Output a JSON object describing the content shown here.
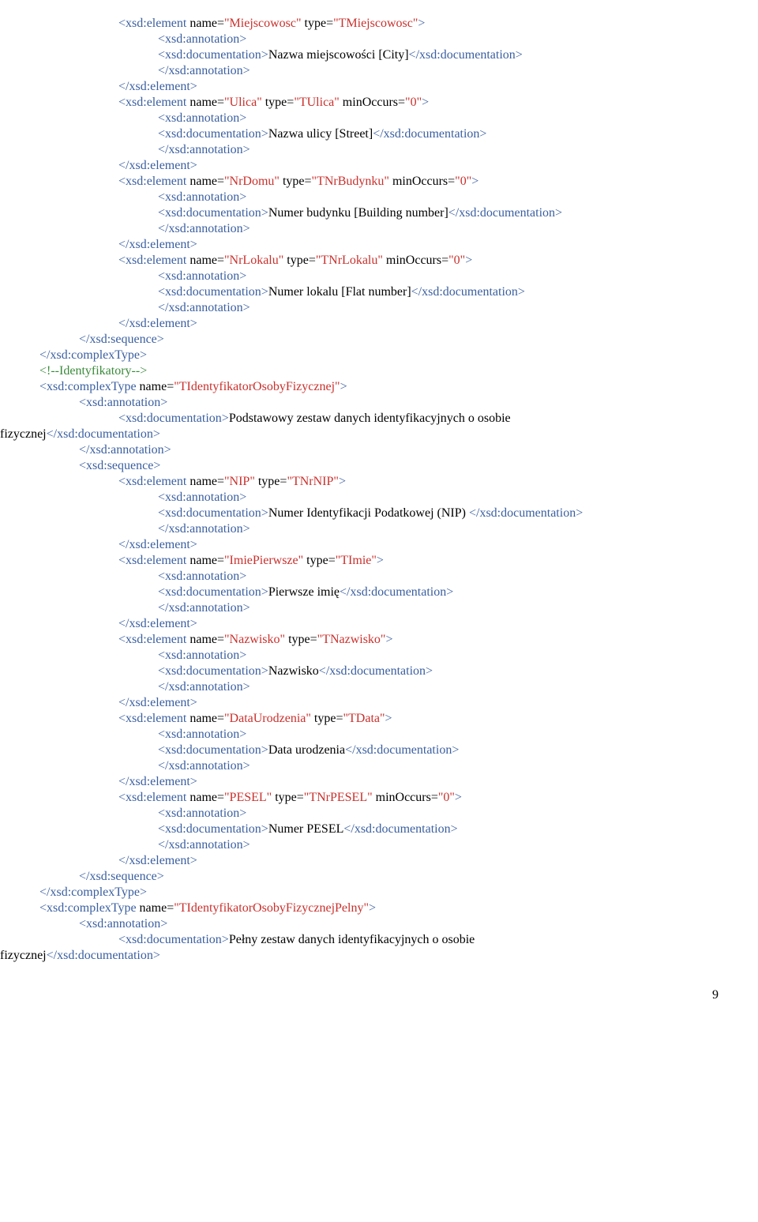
{
  "tag": {
    "el_open": "<xsd:element",
    "el_close": "</xsd:element>",
    "ann_open": "<xsd:annotation>",
    "ann_close": "</xsd:annotation>",
    "doc_open": "<xsd:documentation>",
    "doc_close": "</xsd:documentation>",
    "seq_open": "<xsd:sequence>",
    "seq_close": "</xsd:sequence>",
    "ct_open": "<xsd:complexType",
    "ct_close": "</xsd:complexType>",
    "gt": ">",
    "sp_doc_close": " </xsd:documentation>"
  },
  "attr": {
    "name": " name=",
    "type": " type=",
    "minOccurs": " minOccurs="
  },
  "val": {
    "Miejscowosc": "\"Miejscowosc\"",
    "TMiejscowosc": "\"TMiejscowosc\"",
    "Ulica": "\"Ulica\"",
    "TUlica": "\"TUlica\"",
    "zero": "\"0\"",
    "NrDomu": "\"NrDomu\"",
    "TNrBudynku": "\"TNrBudynku\"",
    "NrLokalu": "\"NrLokalu\"",
    "TNrLokalu": "\"TNrLokalu\"",
    "TIdentOsFiz": "\"TIdentyfikatorOsobyFizycznej\"",
    "NIP": "\"NIP\"",
    "TNrNIP": "\"TNrNIP\"",
    "ImiePierwsze": "\"ImiePierwsze\"",
    "TImie": "\"TImie\"",
    "Nazwisko": "\"Nazwisko\"",
    "TNazwisko": "\"TNazwisko\"",
    "DataUrodzenia": "\"DataUrodzenia\"",
    "TData": "\"TData\"",
    "PESEL": "\"PESEL\"",
    "TNrPESEL": "\"TNrPESEL\"",
    "TIdentOsFizPelny": "\"TIdentyfikatorOsobyFizycznejPelny\""
  },
  "doc": {
    "miejscowosc": "Nazwa miejscowości [City]",
    "ulica": "Nazwa ulicy [Street]",
    "nrdomu": "Numer budynku [Building number]",
    "nrlokalu": "Numer lokalu [Flat number]",
    "identfiz": "Podstawowy zestaw danych identyfikacyjnych o osobie",
    "fizycznej": "fizycznej",
    "nip": "Numer Identyfikacji Podatkowej (NIP)",
    "imie": "Pierwsze imię",
    "nazwisko": "Nazwisko",
    "dataur": "Data urodzenia",
    "pesel": "Numer PESEL",
    "identfizpelny": "Pełny zestaw danych identyfikacyjnych o osobie"
  },
  "comment": {
    "ident": "<!--Identyfikatory-->"
  },
  "page": "9"
}
